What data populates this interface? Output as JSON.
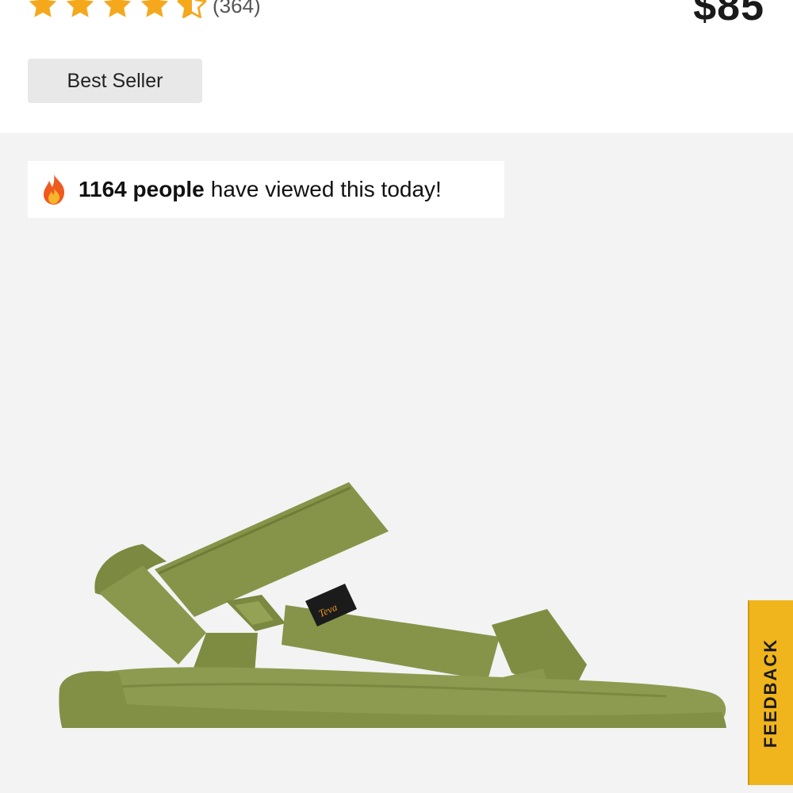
{
  "product": {
    "rating": 4.5,
    "review_count": "(364)",
    "price": "$85",
    "badge": "Best Seller"
  },
  "social_proof": {
    "count_text": "1164 people",
    "rest_text": "have viewed this today!"
  },
  "image": {
    "brand_tag": "Teva",
    "color": "#86944a"
  },
  "feedback": {
    "label": "FEEDBACK"
  },
  "colors": {
    "star": "#f5a81c",
    "feedback_tab": "#f0b41c",
    "gallery_bg": "#f3f3f3",
    "badge_bg": "#e8e8e8"
  }
}
